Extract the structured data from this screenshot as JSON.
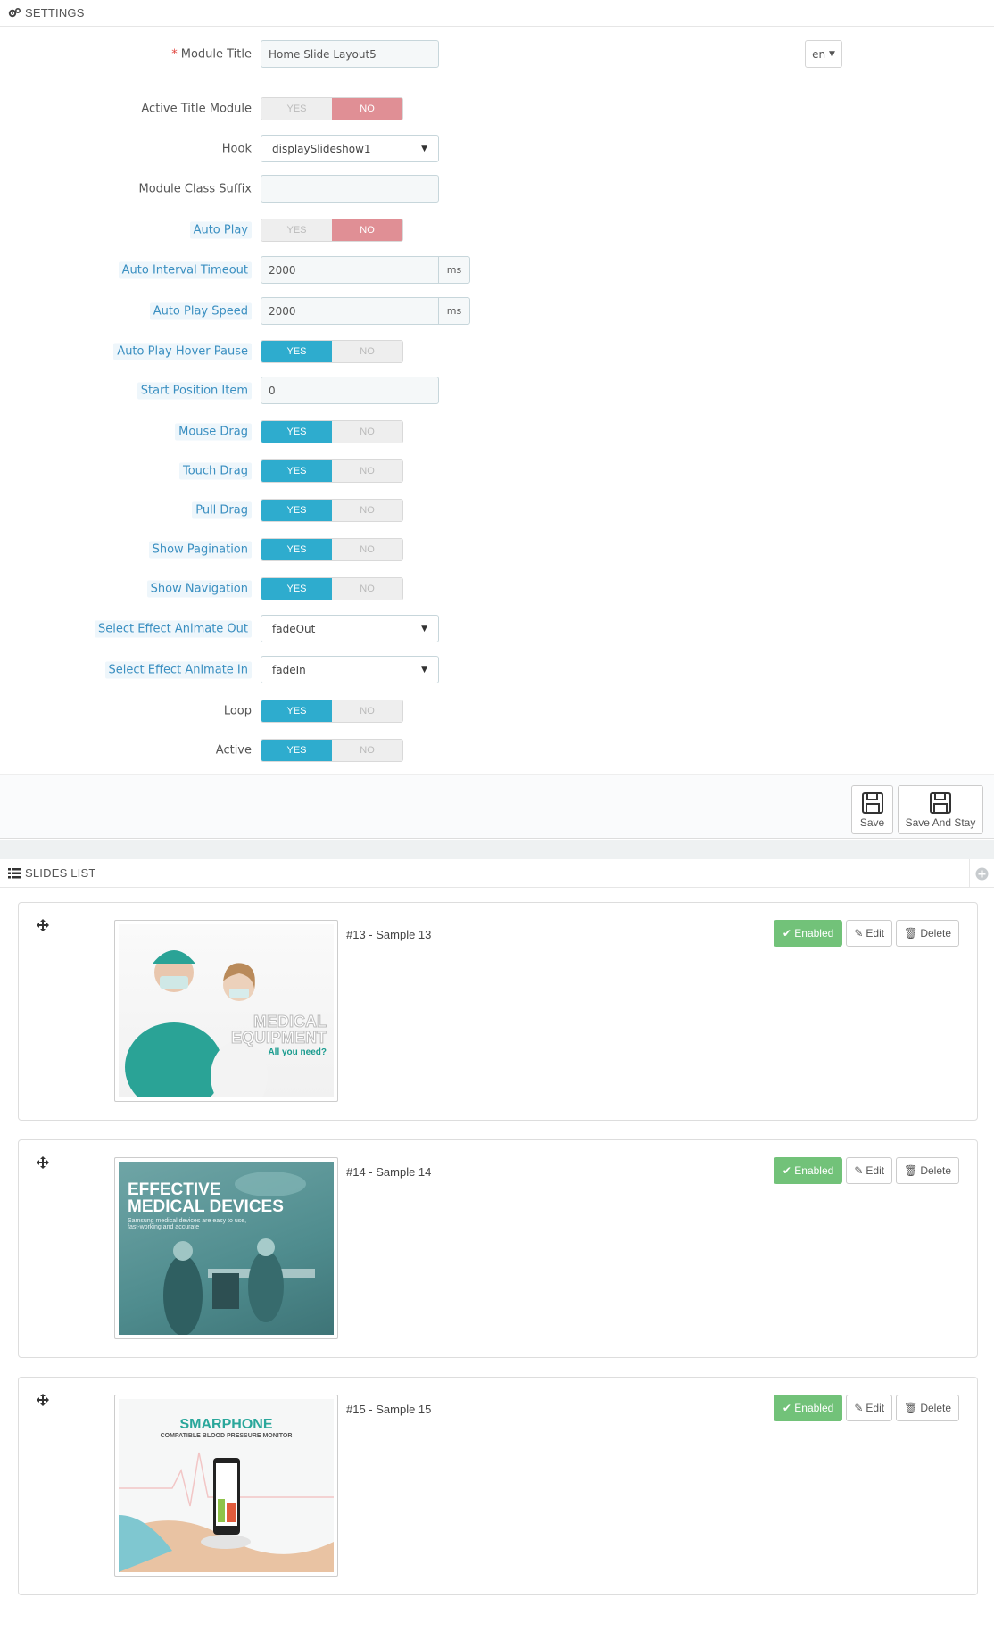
{
  "settings_header": {
    "title": "SETTINGS",
    "icon": "gears-icon"
  },
  "form": {
    "module_title": {
      "label": "Module Title",
      "value": "Home Slide Layout5",
      "lang": "en"
    },
    "active_title_module": {
      "label": "Active Title Module",
      "yes": "YES",
      "no": "NO",
      "value": "NO"
    },
    "hook": {
      "label": "Hook",
      "value": "displaySlideshow1"
    },
    "module_class_suffix": {
      "label": "Module Class Suffix",
      "value": ""
    },
    "auto_play": {
      "label": "Auto Play",
      "yes": "YES",
      "no": "NO",
      "value": "NO"
    },
    "auto_interval_timeout": {
      "label": "Auto Interval Timeout",
      "value": "2000",
      "unit": "ms"
    },
    "auto_play_speed": {
      "label": "Auto Play Speed",
      "value": "2000",
      "unit": "ms"
    },
    "auto_play_hover_pause": {
      "label": "Auto Play Hover Pause",
      "yes": "YES",
      "no": "NO",
      "value": "YES"
    },
    "start_position_item": {
      "label": "Start Position Item",
      "value": "0"
    },
    "mouse_drag": {
      "label": "Mouse Drag",
      "yes": "YES",
      "no": "NO",
      "value": "YES"
    },
    "touch_drag": {
      "label": "Touch Drag",
      "yes": "YES",
      "no": "NO",
      "value": "YES"
    },
    "pull_drag": {
      "label": "Pull Drag",
      "yes": "YES",
      "no": "NO",
      "value": "YES"
    },
    "show_pagination": {
      "label": "Show Pagination",
      "yes": "YES",
      "no": "NO",
      "value": "YES"
    },
    "show_navigation": {
      "label": "Show Navigation",
      "yes": "YES",
      "no": "NO",
      "value": "YES"
    },
    "effect_out": {
      "label": "Select Effect Animate Out",
      "value": "fadeOut"
    },
    "effect_in": {
      "label": "Select Effect Animate In",
      "value": "fadeIn"
    },
    "loop": {
      "label": "Loop",
      "yes": "YES",
      "no": "NO",
      "value": "YES"
    },
    "active": {
      "label": "Active",
      "yes": "YES",
      "no": "NO",
      "value": "YES"
    }
  },
  "footer": {
    "save_label": "Save",
    "save_stay_label": "Save And Stay"
  },
  "slides_header": {
    "title": "SLIDES LIST",
    "icon": "list-icon"
  },
  "slides": [
    {
      "title": "#13 - Sample 13",
      "status": "Enabled",
      "edit": "Edit",
      "delete": "Delete",
      "image_text": {
        "line1": "MEDICAL",
        "line2": "EQUIPMENT",
        "line3": "All you need?"
      }
    },
    {
      "title": "#14 - Sample 14",
      "status": "Enabled",
      "edit": "Edit",
      "delete": "Delete",
      "image_text": {
        "line1": "EFFECTIVE",
        "line2": "MEDICAL DEVICES",
        "line3": "Samsung medical devices are easy to use,",
        "line4": "fast-working and accurate"
      }
    },
    {
      "title": "#15 - Sample 15",
      "status": "Enabled",
      "edit": "Edit",
      "delete": "Delete",
      "image_text": {
        "line1": "SMARPHONE",
        "line2": "COMPATIBLE BLOOD PRESSURE MONITOR"
      }
    }
  ],
  "colors": {
    "accent": "#2eacce",
    "no_on": "#e08f95",
    "enabled": "#72c279",
    "tip_text": "#3a8fc1"
  }
}
